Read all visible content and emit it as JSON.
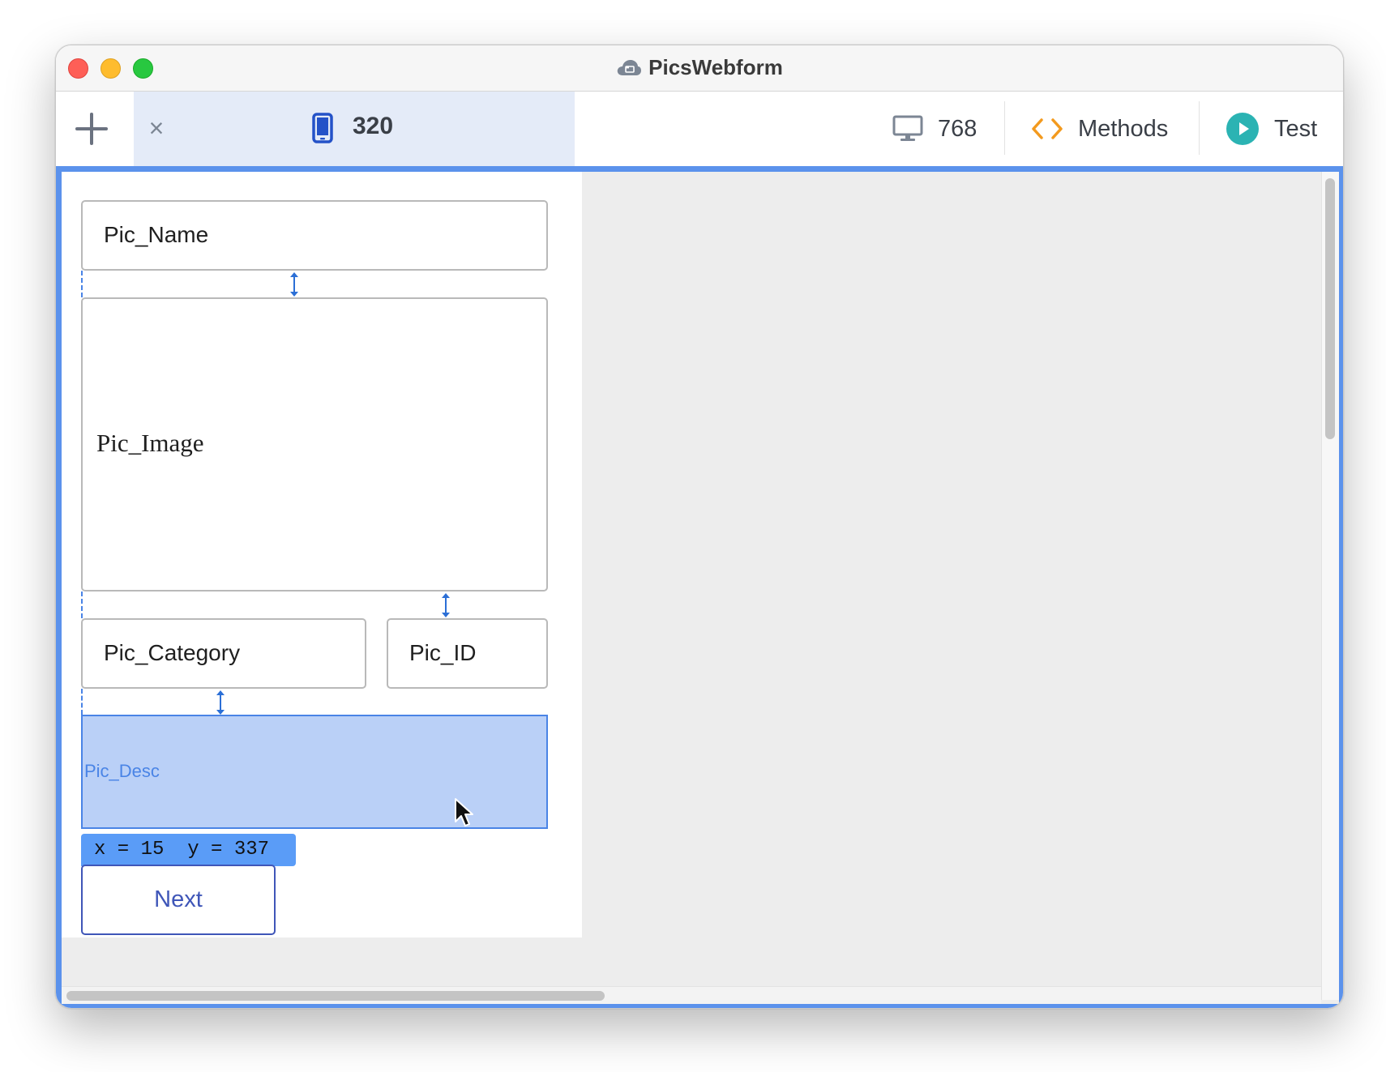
{
  "window": {
    "title": "PicsWebform"
  },
  "toolbar": {
    "active_tab": {
      "label": "320"
    },
    "desktop_tab": {
      "label": "768"
    },
    "methods": {
      "label": "Methods"
    },
    "test": {
      "label": "Test"
    }
  },
  "form": {
    "pic_name": "Pic_Name",
    "pic_image": "Pic_Image",
    "pic_category": "Pic_Category",
    "pic_id": "Pic_ID",
    "pic_desc": "Pic_Desc",
    "coords": "x = 15  y = 337",
    "next_button": "Next"
  },
  "icons": {
    "title": "cloud-icon",
    "add": "plus-icon",
    "close_tab": "close-icon",
    "phone": "phone-icon",
    "desktop": "monitor-icon",
    "methods": "code-brackets-icon",
    "test": "play-icon",
    "cursor": "mouse-pointer-icon"
  },
  "colors": {
    "selection_border": "#5b92ec",
    "selected_fill": "#bad0f7",
    "methods_accent": "#f39a1e",
    "test_accent": "#2bb3b3",
    "phone_accent": "#2452c8",
    "active_tab_bg": "#e4ebf8"
  }
}
